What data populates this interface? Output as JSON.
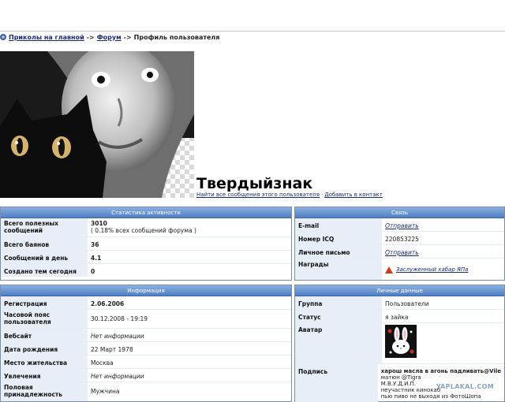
{
  "breadcrumb": {
    "home": "Приколы на главной",
    "sep1": "->",
    "forum": "Форум",
    "sep2": "->",
    "current": "Профиль пользователя"
  },
  "profile": {
    "username": "Твердыйзнак",
    "find_posts": "Найти все сообщения этого пользователя",
    "link_sep": "·",
    "add_contact": "Добавить в контакт"
  },
  "stats": {
    "title": "Статистика активности",
    "rows": [
      {
        "label": "Всего полезных сообщений",
        "value": "3010",
        "sub": "( 0.18% всех сообщений форума )"
      },
      {
        "label": "Всего баянов",
        "value": "36"
      },
      {
        "label": "Сообщений в день",
        "value": "4.1"
      },
      {
        "label": "Создано тем сегодня",
        "value": "0"
      }
    ]
  },
  "contact": {
    "title": "Связь",
    "rows": [
      {
        "label": "E-mail",
        "value": "Отправить"
      },
      {
        "label": "Номер ICQ",
        "value": "220853225"
      },
      {
        "label": "Личное письмо",
        "value": "Отправить"
      },
      {
        "label": "Награды",
        "value": "Заслуженный хабар ЯПа"
      }
    ]
  },
  "info": {
    "title": "Информация",
    "rows": [
      {
        "label": "Регистрация",
        "value": "2.06.2006"
      },
      {
        "label": "Часовой пояс пользователя",
        "value": "30.12.2008 - 19:19"
      },
      {
        "label": "Вебсайт",
        "value": "Нет информации"
      },
      {
        "label": "Дата рождения",
        "value": "22 Март 1978"
      },
      {
        "label": "Место жительства",
        "value": "Москва"
      },
      {
        "label": "Увлечения",
        "value": "Нет информации"
      },
      {
        "label": "Половая принадлежность",
        "value": "Мужчина"
      }
    ]
  },
  "personal": {
    "title": "Личные данные",
    "rows": [
      {
        "label": "Группа",
        "value": "Пользователи"
      },
      {
        "label": "Статус",
        "value": "я зайка"
      },
      {
        "label": "Аватар",
        "value": ""
      },
      {
        "label": "Подпись",
        "lines": [
          "харош масла в агонь падливать@Vile",
          "матюн @Tigra",
          "М.В.У.Д.И.П.",
          "неучастник кинокаб",
          "пью пиво не выходя из ФотоШопа"
        ]
      }
    ]
  },
  "watermark": "YAPLAKAL.COM",
  "colors": {
    "header_gradient_top": "#8cb0e0",
    "header_gradient_bottom": "#4f7fc4",
    "label_bg": "#e8eef7",
    "link": "#1a2c73",
    "award": "#d33b1c"
  }
}
